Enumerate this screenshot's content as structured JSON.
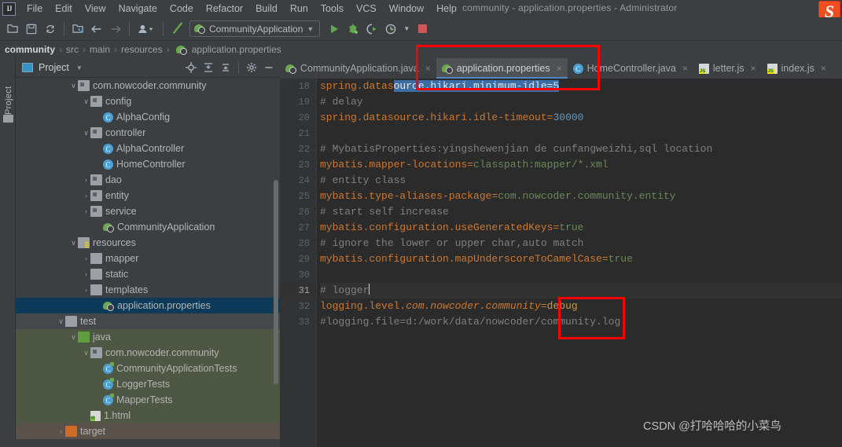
{
  "titlebar": {
    "logo": "IJ",
    "window_title": "community - application.properties - Administrator",
    "brand_logo": "S",
    "menus": [
      {
        "label": "File"
      },
      {
        "label": "Edit"
      },
      {
        "label": "View"
      },
      {
        "label": "Navigate"
      },
      {
        "label": "Code"
      },
      {
        "label": "Refactor"
      },
      {
        "label": "Build"
      },
      {
        "label": "Run"
      },
      {
        "label": "Tools"
      },
      {
        "label": "VCS"
      },
      {
        "label": "Window"
      },
      {
        "label": "Help"
      }
    ]
  },
  "toolbar": {
    "icons": [
      {
        "name": "open-folder-icon",
        "glyph": "☰"
      },
      {
        "name": "save-all-icon",
        "glyph": "⛁"
      },
      {
        "name": "sync-refresh-icon",
        "glyph": "↻"
      },
      {
        "name": "project-structure-icon",
        "glyph": "▣"
      },
      {
        "name": "navigate-back-icon",
        "glyph": "←"
      },
      {
        "name": "navigate-forward-icon",
        "glyph": "→"
      },
      {
        "name": "user-profile-icon",
        "glyph": "♟"
      },
      {
        "name": "build-hammer-icon",
        "glyph": "↖"
      }
    ],
    "run_config_label": "CommunityApplication",
    "run_config_caret": "▼",
    "run_button": "▶",
    "debug_button": "⚇",
    "run_coverage_button": "◑",
    "profile_button": "◔",
    "profile_caret": "▼",
    "stop_button": "stop"
  },
  "breadcrumb": {
    "items": [
      "community",
      "src",
      "main",
      "resources",
      "application.properties"
    ],
    "separator": "›"
  },
  "leftbar": {
    "project_tool_label": "Project"
  },
  "project_panel": {
    "title": "Project",
    "title_caret": "▼",
    "header_icons": [
      {
        "name": "locate-target-icon",
        "glyph": "⌖"
      },
      {
        "name": "expand-all-icon",
        "glyph": "⨅"
      },
      {
        "name": "collapse-all-icon",
        "glyph": "⨄"
      },
      {
        "name": "settings-gear-icon",
        "glyph": "⚙"
      },
      {
        "name": "hide-panel-icon",
        "glyph": "—"
      }
    ],
    "tree": [
      {
        "label": "com.nowcoder.community",
        "indent": 4,
        "arrow": "∨",
        "icon": "package-folder-icon",
        "kind": "pkg"
      },
      {
        "label": "config",
        "indent": 5,
        "arrow": "∨",
        "icon": "package-folder-icon",
        "kind": "pkg"
      },
      {
        "label": "AlphaConfig",
        "indent": 6,
        "arrow": "",
        "icon": "java-class-icon",
        "kind": "class"
      },
      {
        "label": "controller",
        "indent": 5,
        "arrow": "∨",
        "icon": "package-folder-icon",
        "kind": "pkg"
      },
      {
        "label": "AlphaController",
        "indent": 6,
        "arrow": "",
        "icon": "java-class-icon",
        "kind": "class"
      },
      {
        "label": "HomeController",
        "indent": 6,
        "arrow": "",
        "icon": "java-class-icon",
        "kind": "class"
      },
      {
        "label": "dao",
        "indent": 5,
        "arrow": "›",
        "icon": "package-folder-icon",
        "kind": "pkg"
      },
      {
        "label": "entity",
        "indent": 5,
        "arrow": "›",
        "icon": "package-folder-icon",
        "kind": "pkg"
      },
      {
        "label": "service",
        "indent": 5,
        "arrow": "›",
        "icon": "package-folder-icon",
        "kind": "pkg"
      },
      {
        "label": "CommunityApplication",
        "indent": 6,
        "arrow": "",
        "icon": "spring-boot-app-icon",
        "kind": "spring"
      },
      {
        "label": "resources",
        "indent": 4,
        "arrow": "∨",
        "icon": "resources-folder-icon",
        "kind": "res"
      },
      {
        "label": "mapper",
        "indent": 5,
        "arrow": "›",
        "icon": "folder-icon",
        "kind": "plain"
      },
      {
        "label": "static",
        "indent": 5,
        "arrow": "›",
        "icon": "folder-icon",
        "kind": "plain"
      },
      {
        "label": "templates",
        "indent": 5,
        "arrow": "›",
        "icon": "folder-icon",
        "kind": "plain"
      },
      {
        "label": "application.properties",
        "indent": 6,
        "arrow": "",
        "icon": "spring-properties-icon",
        "kind": "spring",
        "state": "selected"
      },
      {
        "label": "test",
        "indent": 3,
        "arrow": "∨",
        "icon": "folder-icon",
        "kind": "plain",
        "state": "test-header"
      },
      {
        "label": "java",
        "indent": 4,
        "arrow": "∨",
        "icon": "test-source-folder-icon",
        "kind": "green",
        "state": "test"
      },
      {
        "label": "com.nowcoder.community",
        "indent": 5,
        "arrow": "∨",
        "icon": "package-folder-icon",
        "kind": "pkg",
        "state": "test"
      },
      {
        "label": "CommunityApplicationTests",
        "indent": 6,
        "arrow": "",
        "icon": "java-test-class-icon",
        "kind": "testclass",
        "state": "test"
      },
      {
        "label": "LoggerTests",
        "indent": 6,
        "arrow": "",
        "icon": "java-test-class-icon",
        "kind": "testclass",
        "state": "test"
      },
      {
        "label": "MapperTests",
        "indent": 6,
        "arrow": "",
        "icon": "java-test-class-icon",
        "kind": "testclass",
        "state": "test"
      },
      {
        "label": "1.html",
        "indent": 5,
        "arrow": "",
        "icon": "html-file-icon",
        "kind": "html",
        "state": "test"
      },
      {
        "label": "target",
        "indent": 3,
        "arrow": "›",
        "icon": "excluded-folder-icon",
        "kind": "orange",
        "state": "target"
      }
    ]
  },
  "editor": {
    "tabs": [
      {
        "label": "CommunityApplication.java",
        "icon": "spring-boot-app-icon",
        "active": false,
        "close": "×"
      },
      {
        "label": "application.properties",
        "icon": "spring-properties-icon",
        "active": true,
        "close": "×"
      },
      {
        "label": "HomeController.java",
        "icon": "java-class-icon",
        "active": false,
        "close": "×"
      },
      {
        "label": "letter.js",
        "icon": "js-file-icon",
        "active": false,
        "close": "×"
      },
      {
        "label": "index.js",
        "icon": "js-file-icon",
        "active": false,
        "close": "×"
      }
    ],
    "current_line": 31,
    "lines": [
      {
        "n": 18,
        "text": "spring.datasource.hikari.minimum-idle=5"
      },
      {
        "n": 19,
        "text": "# delay"
      },
      {
        "n": 20,
        "text": "spring.datasource.hikari.idle-timeout=30000"
      },
      {
        "n": 21,
        "text": ""
      },
      {
        "n": 22,
        "text": "# MybatisProperties:yingshewenjian de cunfangweizhi,sql location"
      },
      {
        "n": 23,
        "text": "mybatis.mapper-locations=classpath:mapper/*.xml"
      },
      {
        "n": 24,
        "text": "# entity class"
      },
      {
        "n": 25,
        "text": "mybatis.type-aliases-package=com.nowcoder.community.entity"
      },
      {
        "n": 26,
        "text": "# start self increase"
      },
      {
        "n": 27,
        "text": "mybatis.configuration.useGeneratedKeys=true"
      },
      {
        "n": 28,
        "text": "# ignore the lower or upper char,auto match"
      },
      {
        "n": 29,
        "text": "mybatis.configuration.mapUnderscoreToCamelCase=true"
      },
      {
        "n": 30,
        "text": ""
      },
      {
        "n": 31,
        "text": "# logger"
      },
      {
        "n": 32,
        "text": "logging.level.com.nowcoder.community=debug"
      },
      {
        "n": 33,
        "text": "#logging.file=d:/work/data/nowcoder/community.log"
      }
    ],
    "line_parts": {
      "l18": {
        "key": "spring.datasource.hikari.minimum-idle",
        "eq": "=",
        "val": "5"
      },
      "l19": {
        "comment": "# delay"
      },
      "l20": {
        "key": "spring.datasource.hikari.idle-timeout",
        "eq": "=",
        "val": "30000"
      },
      "l22": {
        "comment": "# MybatisProperties:yingshewenjian de cunfangweizhi,sql location"
      },
      "l23": {
        "key": "mybatis.mapper-locations",
        "eq": "=",
        "val": "classpath:mapper/*.xml"
      },
      "l24": {
        "comment": "# entity class"
      },
      "l25": {
        "key": "mybatis.type-aliases-package",
        "eq": "=",
        "val": "com.nowcoder.community.entity"
      },
      "l26": {
        "comment": "# start self increase"
      },
      "l27": {
        "key": "mybatis.configuration.useGeneratedKeys",
        "eq": "=",
        "val": "true"
      },
      "l28": {
        "comment": "# ignore the lower or upper char,auto match"
      },
      "l29": {
        "key": "mybatis.configuration.mapUnderscoreToCamelCase",
        "eq": "=",
        "val": "true"
      },
      "l31": {
        "comment": "# logger"
      },
      "l32": {
        "key_a": "logging.level.",
        "key_b": "com.nowcoder.community",
        "eq": "=",
        "val": "debug"
      },
      "l33": {
        "comment": "#logging.file=d:/work/data/nowcoder/community.log"
      }
    }
  },
  "annotations": {
    "boxes": [
      {
        "name": "redbox-tab",
        "target": "application.properties tab"
      },
      {
        "name": "redbox-debug",
        "target": "debug value"
      }
    ],
    "color": "#ff0000"
  },
  "watermark": {
    "text": "CSDN @打哈哈哈的小菜鸟"
  }
}
